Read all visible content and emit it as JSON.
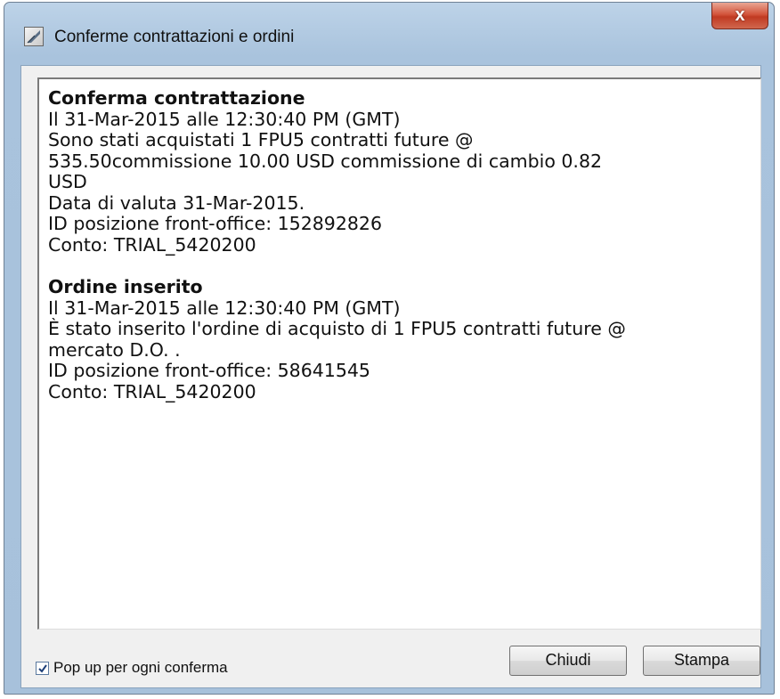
{
  "window": {
    "title": "Conferme contrattazioni e ordini",
    "close_label": "x"
  },
  "messages": [
    {
      "heading": "Conferma contrattazione",
      "lines": [
        "Il 31-Mar-2015 alle 12:30:40 PM (GMT)",
        "Sono stati acquistati 1 FPU5 contratti future @",
        "535.50commissione 10.00 USD commissione di cambio 0.82",
        "USD",
        "Data di valuta 31-Mar-2015.",
        "ID posizione front-office: 152892826",
        "Conto: TRIAL_5420200"
      ]
    },
    {
      "heading": "Ordine inserito",
      "lines": [
        "Il 31-Mar-2015 alle 12:30:40 PM (GMT)",
        "È stato inserito l'ordine di acquisto di 1 FPU5 contratti future @",
        "mercato D.O. .",
        "ID posizione front-office: 58641545",
        "Conto: TRIAL_5420200"
      ]
    }
  ],
  "footer": {
    "popup_checkbox_label": "Pop up per ogni conferma",
    "popup_checked": true,
    "close_button": "Chiudi",
    "print_button": "Stampa"
  }
}
